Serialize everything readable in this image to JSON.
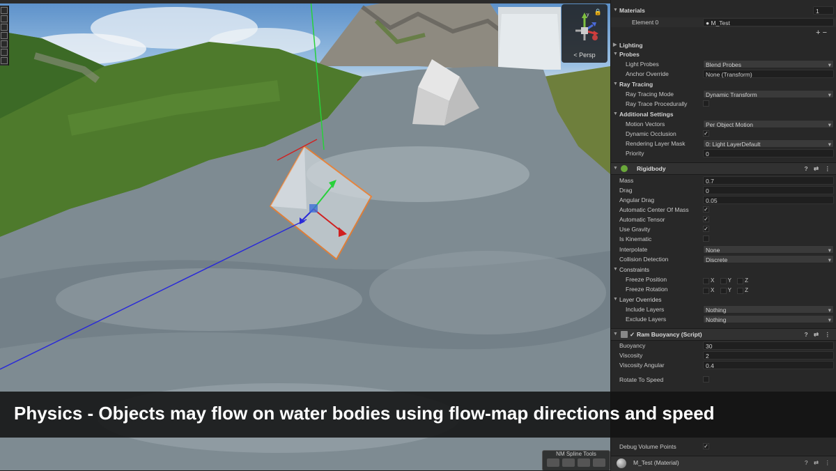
{
  "scene": {
    "view_mode": "Persp",
    "spline_tools_title": "NM Spline Tools"
  },
  "inspector": {
    "materials": {
      "header": "Materials",
      "count": "1",
      "element_label": "Element 0",
      "element_value": "M_Test"
    },
    "lighting_header": "Lighting",
    "probes": {
      "header": "Probes",
      "light_probes_label": "Light Probes",
      "light_probes_value": "Blend Probes",
      "anchor_override_label": "Anchor Override",
      "anchor_override_value": "None (Transform)"
    },
    "ray_tracing": {
      "header": "Ray Tracing",
      "mode_label": "Ray Tracing Mode",
      "mode_value": "Dynamic Transform",
      "procedural_label": "Ray Trace Procedurally"
    },
    "additional": {
      "header": "Additional Settings",
      "motion_vectors_label": "Motion Vectors",
      "motion_vectors_value": "Per Object Motion",
      "dynamic_occlusion_label": "Dynamic Occlusion",
      "layer_mask_label": "Rendering Layer Mask",
      "layer_mask_value": "0: Light LayerDefault",
      "priority_label": "Priority",
      "priority_value": "0"
    },
    "rigidbody": {
      "header": "Rigidbody",
      "mass_label": "Mass",
      "mass_value": "0.7",
      "drag_label": "Drag",
      "drag_value": "0",
      "angular_drag_label": "Angular Drag",
      "angular_drag_value": "0.05",
      "auto_com_label": "Automatic Center Of Mass",
      "auto_tensor_label": "Automatic Tensor",
      "use_gravity_label": "Use Gravity",
      "is_kinematic_label": "Is Kinematic",
      "interpolate_label": "Interpolate",
      "interpolate_value": "None",
      "collision_label": "Collision Detection",
      "collision_value": "Discrete",
      "constraints_header": "Constraints",
      "freeze_pos_label": "Freeze Position",
      "freeze_rot_label": "Freeze Rotation",
      "axis_x": "X",
      "axis_y": "Y",
      "axis_z": "Z",
      "layer_overrides_header": "Layer Overrides",
      "include_label": "Include Layers",
      "include_value": "Nothing",
      "exclude_label": "Exclude Layers",
      "exclude_value": "Nothing"
    },
    "buoyancy": {
      "header": "Ram Buoyancy (Script)",
      "buoyancy_label": "Buoyancy",
      "buoyancy_value": "30",
      "viscosity_label": "Viscosity",
      "viscosity_value": "2",
      "viscosity_angular_label": "Viscosity Angular",
      "viscosity_angular_value": "0.4",
      "rotate_to_speed_label": "Rotate To Speed",
      "debug_volume_label": "Debug Volume Points"
    },
    "material_bar": "M_Test (Material)"
  },
  "caption": "Physics - Objects may flow on water bodies using flow-map directions and speed"
}
